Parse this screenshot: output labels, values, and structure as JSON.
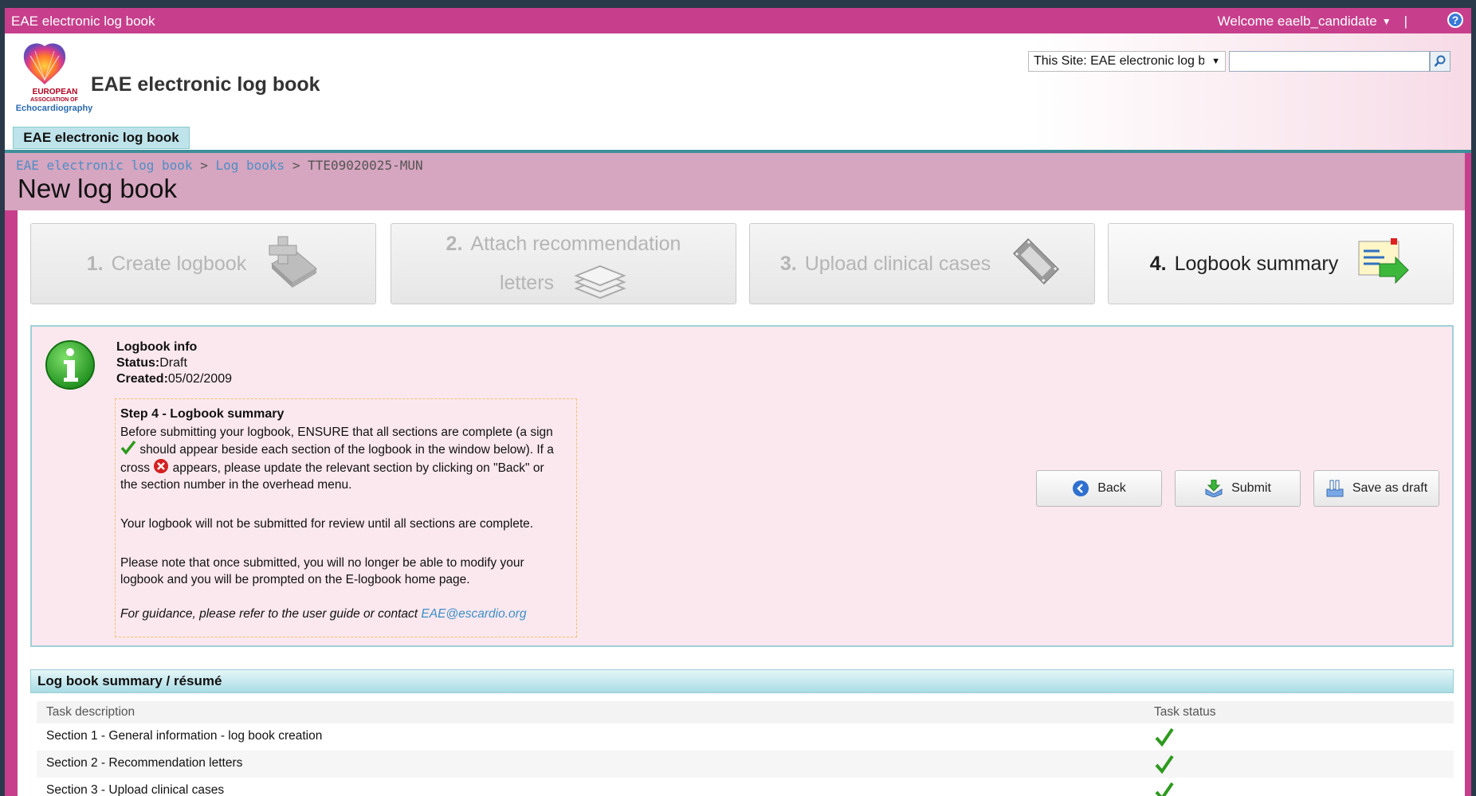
{
  "topbar": {
    "site_name": "EAE electronic log book",
    "welcome": "Welcome eaelb_candidate",
    "separator": "|",
    "help": "?"
  },
  "header": {
    "logo_line1": "EUROPEAN",
    "logo_line2": "ASSOCIATION OF",
    "logo_line3": "Echocardiography",
    "title": "EAE electronic log book",
    "search_scope": "This Site: EAE electronic log bc",
    "search_placeholder": "",
    "home_tab": "EAE electronic log book"
  },
  "breadcrumb": {
    "item1": "EAE electronic log book",
    "sep": ">",
    "item2": "Log books",
    "item3": "TTE09020025-MUN"
  },
  "page_title": "New log book",
  "steps": [
    {
      "num": "1.",
      "label": "Create logbook",
      "icon": "book-plus-icon"
    },
    {
      "num": "2.",
      "label_line1": "Attach recommendation",
      "label_line2": "letters",
      "icon": "layers-icon"
    },
    {
      "num": "3.",
      "label": "Upload clinical cases",
      "icon": "film-icon"
    },
    {
      "num": "4.",
      "label": "Logbook summary",
      "icon": "summary-arrow-icon"
    }
  ],
  "info": {
    "heading": "Logbook info",
    "status_label": "Status:",
    "status_value": "Draft",
    "created_label": "Created:",
    "created_value": "05/02/2009"
  },
  "step4": {
    "heading": "Step 4 - Logbook summary",
    "p1a": "Before submitting your logbook, ENSURE that all sections are complete (a sign",
    "p1b": "should appear beside each section of the logbook in the window below). If a",
    "p1c_pre": "cross",
    "p1c_post": "appears, please update the relevant section by clicking on \"Back\" or",
    "p1d": "the section number in the overhead menu.",
    "p2": "Your logbook will not be submitted for review until all sections are complete.",
    "p3a": "Please note that once submitted, you will no longer be able to modify your",
    "p3b": "logbook and you will be prompted on the E-logbook home page.",
    "guide_text": "For guidance, please refer to the user guide or contact",
    "guide_email": "EAE@escardio.org"
  },
  "buttons": {
    "back": "Back",
    "submit": "Submit",
    "save_draft": "Save as draft"
  },
  "summary": {
    "title": "Log book summary / résumé",
    "col_task": "Task description",
    "col_status": "Task status",
    "rows": [
      {
        "task": "Section 1 - General information - log book creation",
        "status": "complete"
      },
      {
        "task": "Section 2 - Recommendation letters",
        "status": "complete"
      },
      {
        "task": "Section 3 - Upload clinical cases",
        "status": "complete"
      }
    ]
  },
  "colors": {
    "brand_pink": "#c73f8c",
    "title_band": "#d6a5bf",
    "teal": "#3e8f9a",
    "check_green": "#2e9a1e",
    "cross_red": "#d42020"
  }
}
